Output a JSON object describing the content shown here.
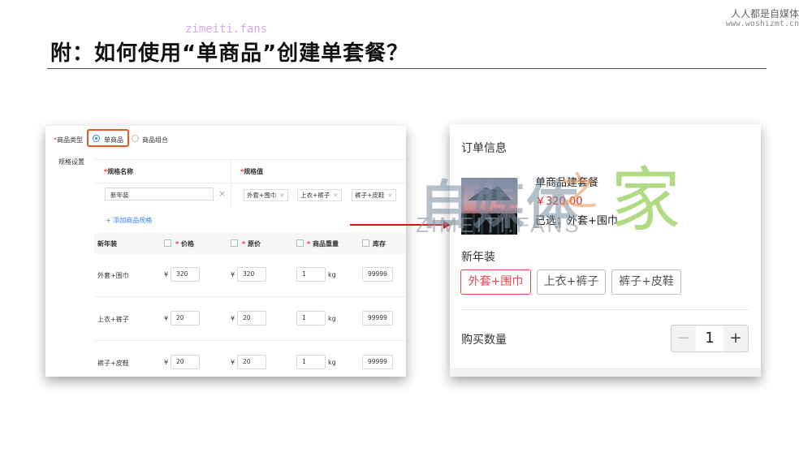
{
  "header": {
    "title": "附：如何使用“单商品”创建单套餐？",
    "site_name_cn": "人人都是自媒体",
    "site_url": "www.woshizmt.cn",
    "top_watermark": "zimeiti.fans"
  },
  "left_form": {
    "product_type_label": "商品类型",
    "type_single": "单商品",
    "type_combo": "商品组合",
    "spec_settings_label": "规格设置",
    "spec_name_header": "规格名称",
    "spec_value_header": "规格值",
    "spec_name_value": "新年装",
    "spec_tags": [
      "外套+围巾",
      "上衣+裤子",
      "裤子+皮鞋"
    ],
    "add_spec_link": "+ 添加商品规格",
    "table_headers": {
      "variant": "新年装",
      "price": "价格",
      "original_price": "原价",
      "weight": "商品重量",
      "stock": "库存"
    },
    "currency": "¥",
    "weight_unit": "kg",
    "rows": [
      {
        "name": "外套+围巾",
        "price": "320",
        "original_price": "320",
        "weight": "1",
        "stock": "99999"
      },
      {
        "name": "上衣+裤子",
        "price": "20",
        "original_price": "20",
        "weight": "1",
        "stock": "99999"
      },
      {
        "name": "裤子+皮鞋",
        "price": "20",
        "original_price": "20",
        "weight": "1",
        "stock": "99999"
      }
    ]
  },
  "order_panel": {
    "title": "订单信息",
    "product_name": "单商品建套餐",
    "price": "￥320.00",
    "selected": "已选：外套+围巾",
    "spec_group": "新年装",
    "options": [
      "外套+围巾",
      "上衣+裤子",
      "裤子+皮鞋"
    ],
    "selected_option_index": 0,
    "quantity_label": "购买数量",
    "quantity": "1",
    "minus": "−",
    "plus": "+"
  },
  "watermark": {
    "cn": "自媒体",
    "zhi": "之",
    "jia": "家",
    "en": "ZIMEITI.FANS"
  },
  "colors": {
    "accent_red": "#d9262c",
    "highlight_orange": "#e65a22",
    "link_blue": "#3b82f6"
  }
}
